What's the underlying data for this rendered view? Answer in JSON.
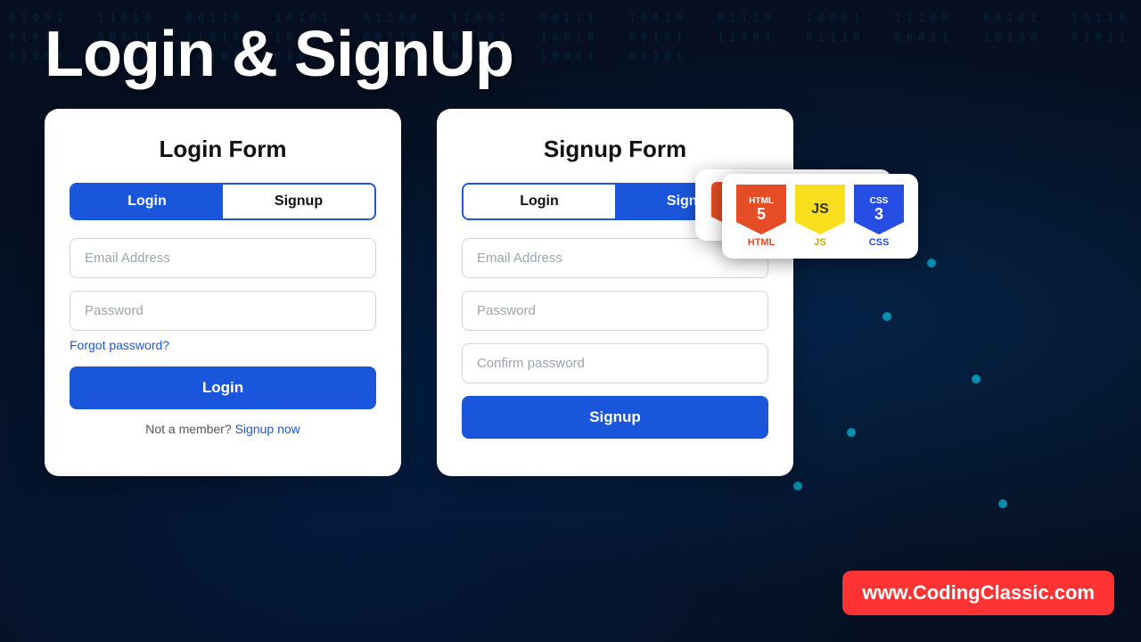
{
  "page": {
    "title": "Login & SignUp",
    "background_color": "#061022"
  },
  "login_form": {
    "title": "Login Form",
    "tab_login": "Login",
    "tab_signup": "Signup",
    "active_tab": "login",
    "email_placeholder": "Email Address",
    "password_placeholder": "Password",
    "forgot_password": "Forgot password?",
    "submit_label": "Login",
    "member_text": "Not a member?",
    "signup_link": "Signup now"
  },
  "signup_form": {
    "title": "Signup Form",
    "tab_login": "Login",
    "tab_signup": "Signup",
    "active_tab": "signup",
    "email_placeholder": "Email Address",
    "password_placeholder": "Password",
    "confirm_placeholder": "Confirm password",
    "submit_label": "Signup"
  },
  "tech_icons": [
    {
      "label": "HTML",
      "number": "5",
      "color": "html"
    },
    {
      "label": "JS",
      "number": "JS",
      "color": "js"
    },
    {
      "label": "CSS",
      "number": "3",
      "color": "css"
    }
  ],
  "url_badge": {
    "text": "www.CodingClassic.com"
  }
}
